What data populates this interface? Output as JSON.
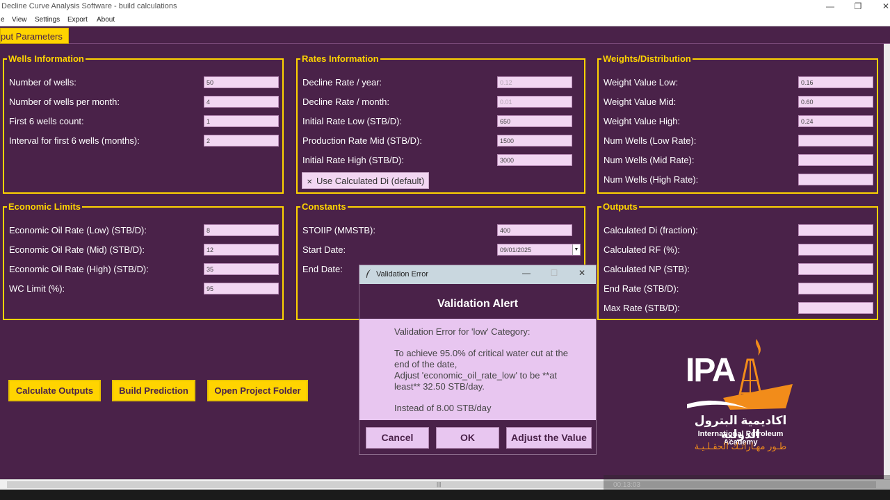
{
  "window": {
    "title": "Decline Curve Analysis Software - build calculations",
    "minimize": "—",
    "maximize": "❐",
    "close": "✕"
  },
  "menu": [
    "e",
    "View",
    "Settings",
    "Export",
    "About"
  ],
  "tab": {
    "label": "put Parameters"
  },
  "wells": {
    "title": "Wells Information",
    "rows": [
      {
        "label": "Number of wells:",
        "value": "50"
      },
      {
        "label": "Number of wells per month:",
        "value": "4"
      },
      {
        "label": "First 6 wells count:",
        "value": "1"
      },
      {
        "label": "Interval for first 6 wells (months):",
        "value": "2"
      }
    ]
  },
  "rates": {
    "title": "Rates Information",
    "rows": [
      {
        "label": "Decline Rate / year:",
        "value": "0.12"
      },
      {
        "label": "Decline Rate / month:",
        "value": "0.01"
      },
      {
        "label": "Initial Rate Low (STB/D):",
        "value": "650"
      },
      {
        "label": "Production Rate Mid (STB/D):",
        "value": "1500"
      },
      {
        "label": "Initial Rate High (STB/D):",
        "value": "3000"
      }
    ],
    "checkbox": {
      "mark": "✕",
      "label": "Use Calculated Di (default)"
    }
  },
  "weights": {
    "title": "Weights/Distribution",
    "rows": [
      {
        "label": "Weight Value Low:",
        "value": "0.16"
      },
      {
        "label": "Weight Value Mid:",
        "value": "0.60"
      },
      {
        "label": "Weight Value High:",
        "value": "0.24"
      },
      {
        "label": "Num Wells (Low Rate):",
        "value": ""
      },
      {
        "label": "Num Wells (Mid Rate):",
        "value": ""
      },
      {
        "label": "Num Wells (High Rate):",
        "value": ""
      }
    ]
  },
  "economic": {
    "title": "Economic Limits",
    "rows": [
      {
        "label": "Economic Oil Rate (Low) (STB/D):",
        "value": "8"
      },
      {
        "label": "Economic Oil Rate (Mid) (STB/D):",
        "value": "12"
      },
      {
        "label": "Economic Oil Rate (High) (STB/D):",
        "value": "35"
      },
      {
        "label": "WC Limit (%):",
        "value": "95"
      }
    ]
  },
  "constants": {
    "title": "Constants",
    "rows": [
      {
        "label": "STOIIP (MMSTB):",
        "value": "400"
      },
      {
        "label": "Start Date:",
        "value": "09/01/2025"
      },
      {
        "label": "End Date:",
        "value": ""
      }
    ],
    "dropdown_arrow": "▼"
  },
  "outputs": {
    "title": "Outputs",
    "rows": [
      {
        "label": "Calculated Di (fraction):",
        "value": ""
      },
      {
        "label": "Calculated RF (%):",
        "value": ""
      },
      {
        "label": "Calculated NP (STB):",
        "value": ""
      },
      {
        "label": "End Rate (STB/D):",
        "value": ""
      },
      {
        "label": "Max Rate (STB/D):",
        "value": ""
      }
    ]
  },
  "actions": {
    "calculate": "Calculate Outputs",
    "build": "Build Prediction",
    "open_folder": "Open Project Folder"
  },
  "dialog": {
    "window_title": "Validation Error",
    "header": "Validation Alert",
    "line1": "Validation Error for 'low' Category:",
    "line2": "To achieve 95.0% of critical water cut at the end of the date,",
    "line3": "Adjust 'economic_oil_rate_low' to be **at least** 32.50 STB/day.",
    "line4": "Instead of 8.00 STB/day",
    "cancel": "Cancel",
    "ok": "OK",
    "adjust": "Adjust the Value",
    "minimize": "—",
    "maximize": "☐",
    "close": "✕"
  },
  "logo": {
    "mark": "IPA",
    "arabic": "اكاديمية البترول الدولية",
    "english": "International Petroleum Academy",
    "slogan": "طـور مهـاراتـك الحقـلـيـة"
  },
  "playback": {
    "time": "00:13:03"
  },
  "colors": {
    "background": "#4a2249",
    "accent": "#ffd400",
    "field": "#f2d6f2",
    "dialog": "#e8c6f0",
    "logo_orange": "#f28c1a"
  }
}
